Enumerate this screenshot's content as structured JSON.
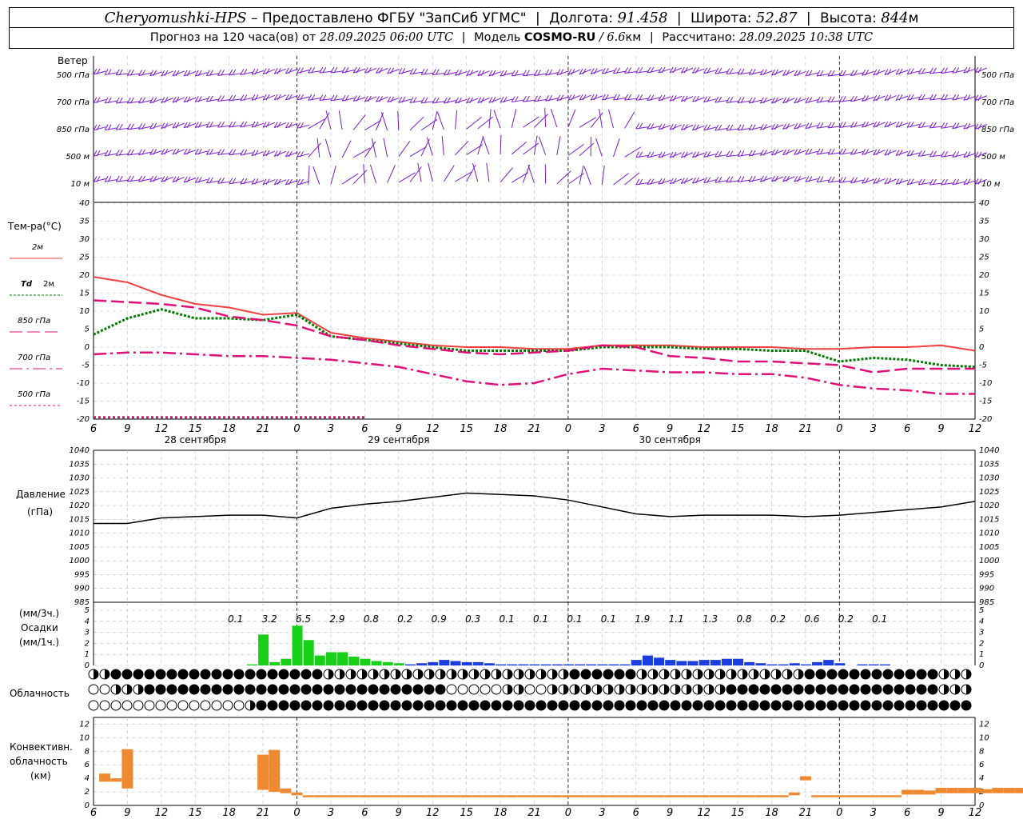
{
  "header": {
    "station": "Cheryomushki-HPS",
    "provider_prefix": "– Предоставлено ФГБУ",
    "provider": "\"ЗапСиб УГМС\"",
    "lon_label": "Долгота:",
    "lon_value": "91.458",
    "lat_label": "Широта:",
    "lat_value": "52.87",
    "alt_label": "Высота:",
    "alt_value": "844",
    "alt_unit": "м",
    "forecast_label": "Прогноз на 120 часа(ов) от",
    "forecast_start": "28.09.2025 06:00 UTC",
    "model_label": "Модель",
    "model_name": "COSMO-RU",
    "model_res": "/ 6.6",
    "model_res_unit": "км",
    "computed_label": "Рассчитано:",
    "computed_time": "28.09.2025 10:38 UTC"
  },
  "colors": {
    "t2m": "#f04040",
    "td2m": "#007a00",
    "t850": "#e0107a",
    "t700": "#e0107a",
    "t500": "#e0107a",
    "pressure": "#000000",
    "precip_green": "#18d018",
    "precip_blue": "#1a3ddd",
    "convective": "#f08a30",
    "wind": "#7a1ccf"
  },
  "wind_panel": {
    "title": "Ветер",
    "levels": [
      "500 гПа",
      "700 гПа",
      "850 гПа",
      "500 м",
      "10  м"
    ]
  },
  "time_axis": {
    "hour_labels": [
      "6",
      "9",
      "12",
      "15",
      "18",
      "21",
      "0",
      "3",
      "6",
      "9",
      "12",
      "15",
      "18",
      "21",
      "0",
      "3",
      "6",
      "9",
      "12",
      "15",
      "18",
      "21",
      "0",
      "3",
      "6",
      "9",
      "12"
    ],
    "day_labels": [
      "28 сентября",
      "29 сентября",
      "30 сентября"
    ]
  },
  "chart_data": [
    {
      "type": "line",
      "panel": "temperature",
      "title": "Тем-ра(°C)",
      "ylim": [
        -20,
        40
      ],
      "yticks": [
        -20,
        -15,
        -10,
        -5,
        0,
        5,
        10,
        15,
        20,
        25,
        30,
        35,
        40
      ],
      "x_hours": [
        0,
        3,
        6,
        9,
        12,
        15,
        18,
        21,
        24,
        27,
        30,
        33,
        36,
        39,
        42,
        45,
        48,
        51,
        54,
        57,
        60,
        63,
        66,
        69,
        72,
        75,
        78
      ],
      "legend": [
        {
          "label": "2м",
          "series": "t2m"
        },
        {
          "label": "Td",
          "sub": "2м",
          "series": "td2m"
        },
        {
          "label": "850 гПа",
          "series": "t850"
        },
        {
          "label": "700 гПа",
          "series": "t700"
        },
        {
          "label": "500 гПа",
          "series": "t500"
        }
      ],
      "series": [
        {
          "key": "t2m",
          "values": [
            19.5,
            18,
            14.5,
            12,
            11,
            9,
            9.5,
            4,
            2.5,
            1.5,
            0.5,
            0,
            0,
            -0.5,
            -0.5,
            0.5,
            0.5,
            0.5,
            0,
            0,
            0,
            -0.5,
            -0.5,
            0,
            0,
            0.5,
            -1
          ]
        },
        {
          "key": "td2m",
          "values": [
            3.5,
            8,
            10.5,
            8,
            8,
            7.5,
            9,
            3,
            2,
            1,
            0,
            -1,
            -1,
            -1,
            -1,
            0,
            0,
            0,
            -0.5,
            -0.5,
            -1,
            -1,
            -4,
            -3,
            -3.5,
            -5,
            -5.5
          ]
        },
        {
          "key": "t850",
          "values": [
            13,
            12.5,
            12,
            11,
            8.5,
            7.5,
            6,
            3,
            2,
            0.5,
            -0.5,
            -1.5,
            -2,
            -1.5,
            -1,
            0.5,
            0,
            -2.5,
            -3,
            -4,
            -4,
            -4.5,
            -5,
            -7,
            -6,
            -6,
            -6
          ]
        },
        {
          "key": "t700",
          "values": [
            -2,
            -1.5,
            -1.5,
            -2,
            -2.5,
            -2.5,
            -3,
            -3.5,
            -4.5,
            -5.5,
            -7.5,
            -9.5,
            -10.5,
            -10,
            -7.5,
            -6,
            -6.5,
            -7,
            -7,
            -7.5,
            -7.5,
            -8.5,
            -10.5,
            -11.5,
            -12,
            -13,
            -13
          ]
        },
        {
          "key": "t500",
          "values": [
            -19.5,
            -19.5,
            -19.5,
            -19.5,
            -19.5,
            -19.5,
            -19.5,
            -19.5,
            -19.5
          ]
        }
      ]
    },
    {
      "type": "line",
      "panel": "pressure",
      "title": "Давление",
      "unit": "(гПа)",
      "ylim": [
        985,
        1040
      ],
      "yticks": [
        985,
        990,
        995,
        1000,
        1005,
        1010,
        1015,
        1020,
        1025,
        1030,
        1035,
        1040
      ],
      "x_hours": [
        0,
        3,
        6,
        9,
        12,
        15,
        18,
        21,
        24,
        27,
        30,
        33,
        36,
        39,
        42,
        45,
        48,
        51,
        54,
        57,
        60,
        63,
        66,
        69,
        72,
        75,
        78
      ],
      "series": [
        {
          "key": "pressure",
          "values": [
            1013.5,
            1013.5,
            1015.5,
            1016,
            1016.5,
            1016.5,
            1015.5,
            1019,
            1020.5,
            1021.5,
            1023,
            1024.5,
            1024,
            1023.5,
            1022,
            1019.5,
            1017,
            1016,
            1016.5,
            1016.5,
            1016.5,
            1016,
            1016.5,
            1017.5,
            1018.5,
            1019.5,
            1021.5
          ]
        }
      ]
    },
    {
      "type": "bar",
      "panel": "precipitation",
      "title": "Осадки",
      "units": [
        "(мм/3ч.)",
        "(мм/1ч.)"
      ],
      "ylim": [
        0,
        5
      ],
      "yticks": [
        0,
        1,
        2,
        3,
        4,
        5
      ],
      "sums_3h": [
        {
          "hour": 12,
          "text": "0.1"
        },
        {
          "hour": 15,
          "text": "3.2"
        },
        {
          "hour": 18,
          "text": "6.5"
        },
        {
          "hour": 21,
          "text": "2.9"
        },
        {
          "hour": 24,
          "text": "0.8"
        },
        {
          "hour": 27,
          "text": "0.2"
        },
        {
          "hour": 30,
          "text": "0.9"
        },
        {
          "hour": 33,
          "text": "0.3"
        },
        {
          "hour": 36,
          "text": "0.1"
        },
        {
          "hour": 39,
          "text": "0.1"
        },
        {
          "hour": 42,
          "text": "0.1"
        },
        {
          "hour": 45,
          "text": "0.1"
        },
        {
          "hour": 48,
          "text": "1.9"
        },
        {
          "hour": 51,
          "text": "1.1"
        },
        {
          "hour": 54,
          "text": "1.3"
        },
        {
          "hour": 57,
          "text": "0.8"
        },
        {
          "hour": 60,
          "text": "0.2"
        },
        {
          "hour": 63,
          "text": "0.6"
        },
        {
          "hour": 66,
          "text": "0.2"
        },
        {
          "hour": 69,
          "text": "0.1"
        }
      ],
      "bars_1h": [
        {
          "h": 14,
          "v": 0.1
        },
        {
          "h": 15,
          "v": 2.8
        },
        {
          "h": 16,
          "v": 0.3
        },
        {
          "h": 17,
          "v": 0.6
        },
        {
          "h": 18,
          "v": 3.6
        },
        {
          "h": 19,
          "v": 2.3
        },
        {
          "h": 20,
          "v": 0.9
        },
        {
          "h": 21,
          "v": 1.2
        },
        {
          "h": 22,
          "v": 1.2
        },
        {
          "h": 23,
          "v": 0.8
        },
        {
          "h": 24,
          "v": 0.6
        },
        {
          "h": 25,
          "v": 0.4
        },
        {
          "h": 26,
          "v": 0.3
        },
        {
          "h": 27,
          "v": 0.2
        },
        {
          "h": 28,
          "v": 0.1
        },
        {
          "h": 29,
          "v": 0.2
        },
        {
          "h": 30,
          "v": 0.3
        },
        {
          "h": 31,
          "v": 0.5
        },
        {
          "h": 32,
          "v": 0.4
        },
        {
          "h": 33,
          "v": 0.3
        },
        {
          "h": 34,
          "v": 0.3
        },
        {
          "h": 35,
          "v": 0.2
        },
        {
          "h": 36,
          "v": 0.1
        },
        {
          "h": 37,
          "v": 0.1
        },
        {
          "h": 38,
          "v": 0.1
        },
        {
          "h": 39,
          "v": 0.1
        },
        {
          "h": 40,
          "v": 0.1
        },
        {
          "h": 41,
          "v": 0.1
        },
        {
          "h": 42,
          "v": 0.1
        },
        {
          "h": 43,
          "v": 0.1
        },
        {
          "h": 44,
          "v": 0.1
        },
        {
          "h": 45,
          "v": 0.1
        },
        {
          "h": 46,
          "v": 0.1
        },
        {
          "h": 47,
          "v": 0.1
        },
        {
          "h": 48,
          "v": 0.5
        },
        {
          "h": 49,
          "v": 0.9
        },
        {
          "h": 50,
          "v": 0.7
        },
        {
          "h": 51,
          "v": 0.5
        },
        {
          "h": 52,
          "v": 0.4
        },
        {
          "h": 53,
          "v": 0.4
        },
        {
          "h": 54,
          "v": 0.5
        },
        {
          "h": 55,
          "v": 0.5
        },
        {
          "h": 56,
          "v": 0.6
        },
        {
          "h": 57,
          "v": 0.6
        },
        {
          "h": 58,
          "v": 0.3
        },
        {
          "h": 59,
          "v": 0.2
        },
        {
          "h": 60,
          "v": 0.1
        },
        {
          "h": 61,
          "v": 0.1
        },
        {
          "h": 62,
          "v": 0.2
        },
        {
          "h": 63,
          "v": 0.1
        },
        {
          "h": 64,
          "v": 0.3
        },
        {
          "h": 65,
          "v": 0.5
        },
        {
          "h": 66,
          "v": 0.2
        },
        {
          "h": 67,
          "v": 0.0
        },
        {
          "h": 68,
          "v": 0.1
        },
        {
          "h": 69,
          "v": 0.1
        },
        {
          "h": 70,
          "v": 0.1
        }
      ]
    },
    {
      "type": "bar",
      "panel": "convective_cloud",
      "title": [
        "Конвективн.",
        "облачность",
        "(км)"
      ],
      "ylim": [
        0,
        13
      ],
      "yticks": [
        0,
        2,
        4,
        6,
        8,
        10,
        12
      ],
      "bars": [
        {
          "h": 1,
          "b": 3.5,
          "t": 4.7
        },
        {
          "h": 2,
          "b": 3.5,
          "t": 4.0
        },
        {
          "h": 3,
          "b": 2.5,
          "t": 8.3
        },
        {
          "h": 15,
          "b": 2.3,
          "t": 7.5
        },
        {
          "h": 16,
          "b": 2.0,
          "t": 8.2
        },
        {
          "h": 17,
          "b": 1.8,
          "t": 2.5
        },
        {
          "h": 18,
          "b": 1.5,
          "t": 1.9
        },
        {
          "h": 63,
          "b": 3.7,
          "t": 4.3
        },
        {
          "h": 62,
          "b": 1.5,
          "t": 1.9
        },
        {
          "h": 72,
          "b": 1.6,
          "t": 2.3
        },
        {
          "h": 73,
          "b": 1.6,
          "t": 2.3
        },
        {
          "h": 74,
          "b": 1.6,
          "t": 2.2
        },
        {
          "h": 75,
          "b": 1.8,
          "t": 2.6
        },
        {
          "h": 76,
          "b": 1.8,
          "t": 2.6
        },
        {
          "h": 77,
          "b": 1.8,
          "t": 2.6
        },
        {
          "h": 78,
          "b": 1.8,
          "t": 2.6
        },
        {
          "h": 79,
          "b": 1.8,
          "t": 2.4
        },
        {
          "h": 80,
          "b": 1.8,
          "t": 2.6
        },
        {
          "h": 81,
          "b": 1.8,
          "t": 2.6
        },
        {
          "h": 82,
          "b": 1.8,
          "t": 2.6
        }
      ]
    },
    {
      "type": "table",
      "panel": "cloudiness",
      "title": "Облачность",
      "rows": [
        "mmmfffffffffffffffffffffffffffffffmmmmmmmmmmmmmmmmmmmmmmmmmmmmmmmmmmmmffffffffffmmmmmmmmmmmmmmmmmmmmmmmmmffffffffffffffffffffmmmmmm",
        "eemmmmmfffffffffffffffffffffffffffffffffffffffffffffeeeeeeemmmmeeemmmmmmmmmmmmmmmmmmmmmmmmmmmffffffffffffffffffffffffffffffmmmmmm",
        "eeeeeeeeeeeeeeeeeeeeeemffffffffffffffffffffffffffffffffffffffffffffffffffffffffffffffffffffffffffffffffffffffffffffffffffffffff"
      ]
    }
  ]
}
